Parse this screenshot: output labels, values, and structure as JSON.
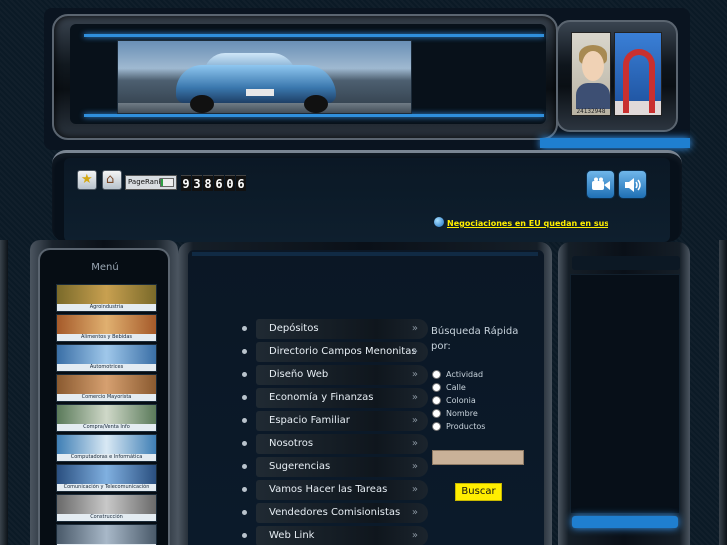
{
  "header": {
    "banner_alt": "car banner",
    "photo_caption": "24132948"
  },
  "toolbar": {
    "icons": [
      "favorites-icon",
      "home-icon"
    ],
    "pagerank_label": "PageRank",
    "pagerank_value": 2,
    "pagerank_max": 10,
    "counter_digits": [
      "9",
      "3",
      "8",
      "6",
      "0",
      "6"
    ],
    "media_buttons": [
      "video-camera-icon",
      "speaker-icon"
    ],
    "news_text": "Negociaciones en EU quedan en suspen"
  },
  "menu": {
    "title": "Menú",
    "items": [
      {
        "label": "Agroindustria",
        "color1": "#7a6a2a",
        "color2": "#c8a050"
      },
      {
        "label": "Alimentos y Bebidas",
        "color1": "#a55a2a",
        "color2": "#e0b070"
      },
      {
        "label": "Automotrices",
        "color1": "#3a6fa6",
        "color2": "#9fc7ea"
      },
      {
        "label": "Comercio Mayorista",
        "color1": "#8a5a30",
        "color2": "#d6a070"
      },
      {
        "label": "Compra/Venta Info",
        "color1": "#5a7a5a",
        "color2": "#cfd8c8"
      },
      {
        "label": "Computadoras e Informática",
        "color1": "#3f7fb5",
        "color2": "#d8e8f4"
      },
      {
        "label": "Comunicación y Telecomunicación",
        "color1": "#2a4f80",
        "color2": "#80b0e0"
      },
      {
        "label": "Construcción",
        "color1": "#6a6a6a",
        "color2": "#c8c8c8"
      },
      {
        "label": "",
        "color1": "#4a5a6a",
        "color2": "#a8b8c8"
      }
    ]
  },
  "nav": {
    "items": [
      "Depósitos",
      "Directorio Campos Menonitas",
      "Diseño Web",
      "Economía y Finanzas",
      "Espacio Familiar",
      "Nosotros",
      "Sugerencias",
      "Vamos Hacer las Tareas",
      "Vendedores Comisionistas",
      "Web Link"
    ],
    "chevron": "»"
  },
  "search": {
    "title": "Búsqueda Rápida por:",
    "options": [
      "Actividad",
      "Calle",
      "Colonia",
      "Nombre",
      "Productos"
    ],
    "input_value": "",
    "button_label": "Buscar"
  },
  "colors": {
    "accent_blue": "#1f7fd0",
    "news_yellow": "#ffee00",
    "button_yellow": "#ffee00",
    "input_tan": "#c9b198"
  }
}
